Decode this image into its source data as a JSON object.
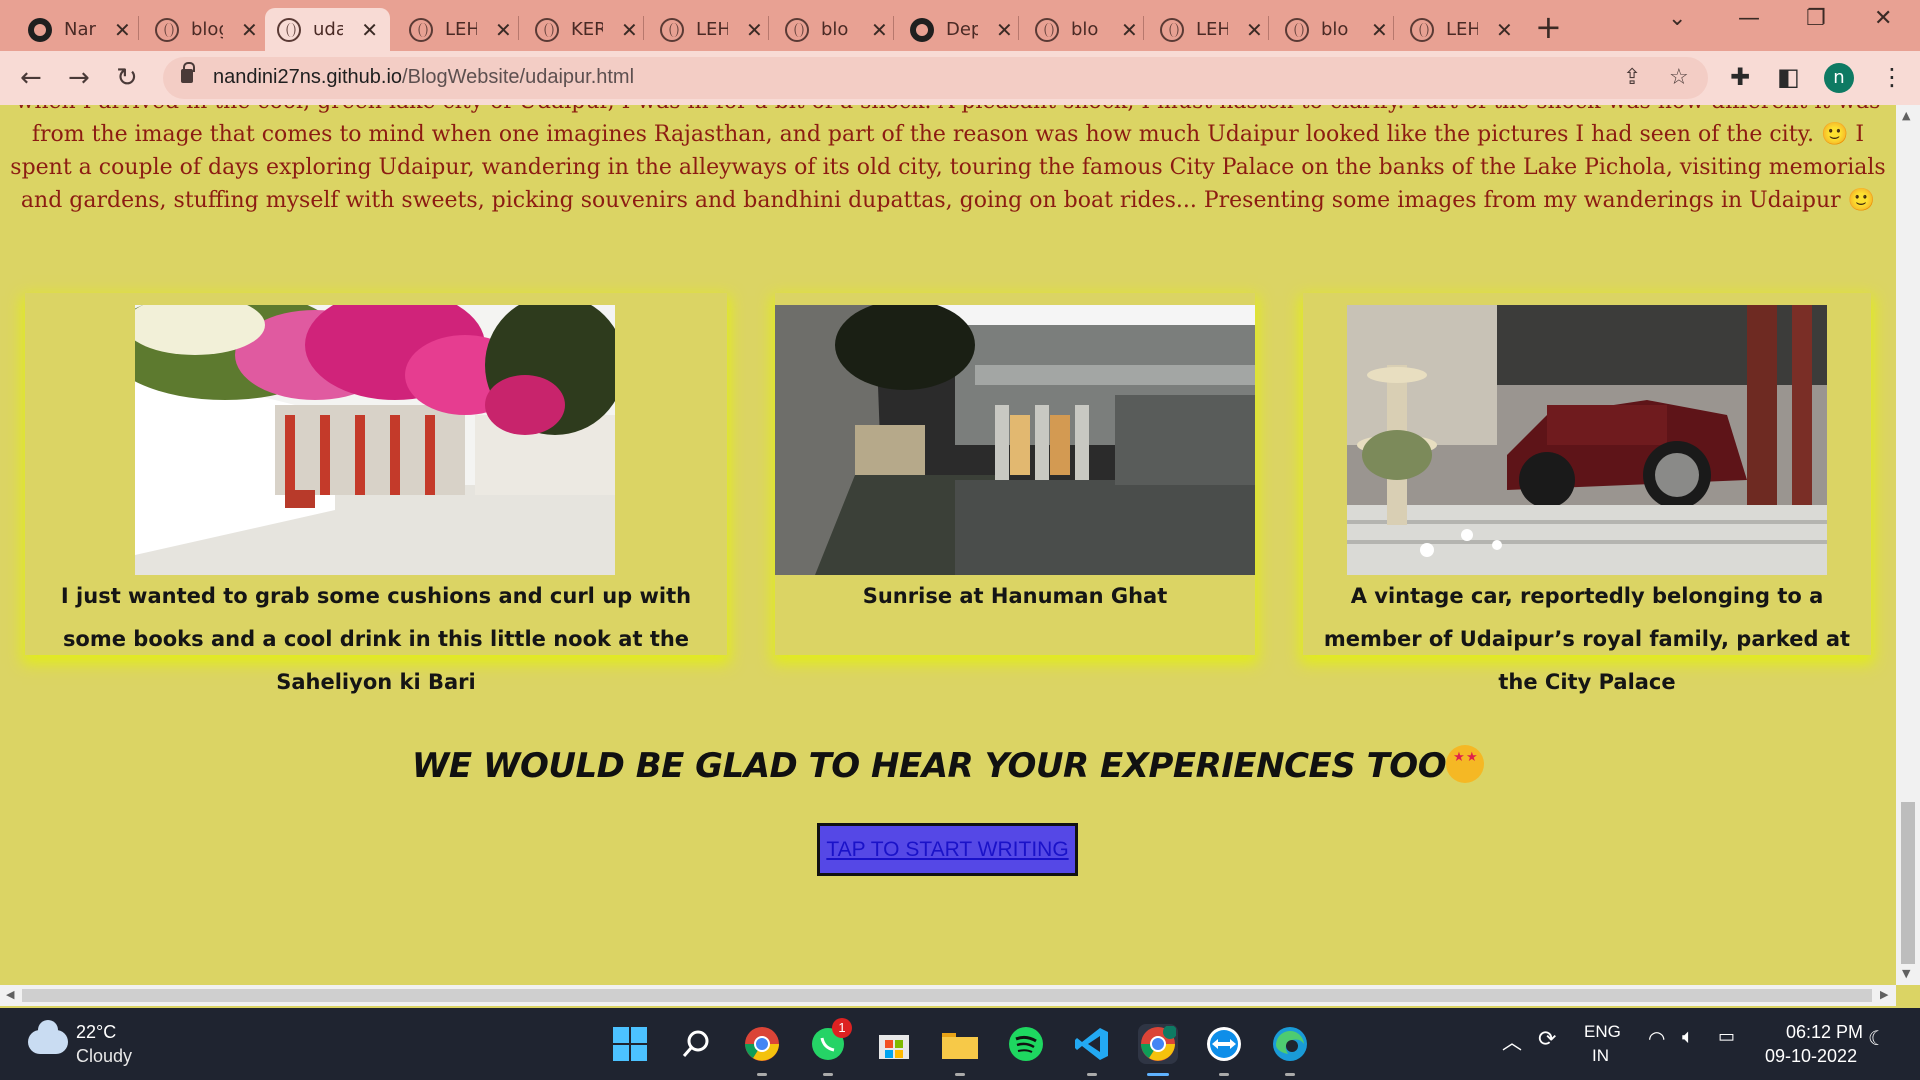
{
  "browser": {
    "tabs": [
      {
        "label": "Nar",
        "icon": "github-icon"
      },
      {
        "label": "blog",
        "icon": "globe-icon"
      },
      {
        "label": "uda",
        "icon": "globe-icon",
        "active": true
      },
      {
        "label": "LEH",
        "icon": "globe-icon"
      },
      {
        "label": "KER",
        "icon": "globe-icon"
      },
      {
        "label": "LEH",
        "icon": "globe-icon"
      },
      {
        "label": "blo",
        "icon": "globe-icon"
      },
      {
        "label": "Dep",
        "icon": "github-icon"
      },
      {
        "label": "blo",
        "icon": "globe-icon"
      },
      {
        "label": "LEH",
        "icon": "globe-icon"
      },
      {
        "label": "blo",
        "icon": "globe-icon"
      },
      {
        "label": "LEH",
        "icon": "globe-icon"
      }
    ],
    "url_host": "nandini27ns.github.io",
    "url_path": "/BlogWebsite/udaipur.html",
    "profile_initial": "n"
  },
  "page": {
    "intro_partial": "when I arrived in the cool, green lake city of Udaipur, I was in for a bit of a shock. A pleasant shock, I must hasten to clarify. Part of the shock was how different it was from the image that comes to mind when one imagines Rajasthan, and part of the reason was how much Udaipur looked like the pictures I had seen of the city. 🙂 I spent a couple of days exploring Udaipur, wandering in the alleyways of its old city, touring the famous City Palace on the banks of the Lake Pichola, visiting memorials and gardens, stuffing myself with sweets, picking souvenirs and bandhini dupattas, going on boat rides... Presenting some images from my wanderings in Udaipur 🙂",
    "cards": [
      {
        "caption": "I just wanted to grab some cushions and curl up with some books and a cool drink in this little nook at the Saheliyon ki Bari"
      },
      {
        "caption": "Sunrise at Hanuman Ghat"
      },
      {
        "caption": "A vintage car, reportedly belonging to a member of Udaipur’s royal family, parked at the City Palace"
      }
    ],
    "cta_heading": "WE WOULD BE GLAD TO HEAR YOUR EXPERIENCES TOO",
    "cta_button": "TAP TO START WRITING"
  },
  "taskbar": {
    "weather_temp": "22°C",
    "weather_desc": "Cloudy",
    "whatsapp_badge": "1",
    "lang_line1": "ENG",
    "lang_line2": "IN",
    "time": "06:12 PM",
    "date": "09-10-2022"
  },
  "colors": {
    "page_bg": "#dbd464",
    "intro_text": "#8c1c12",
    "card_glow": "#e2ec1c",
    "cta_button_bg": "#5548e6"
  }
}
